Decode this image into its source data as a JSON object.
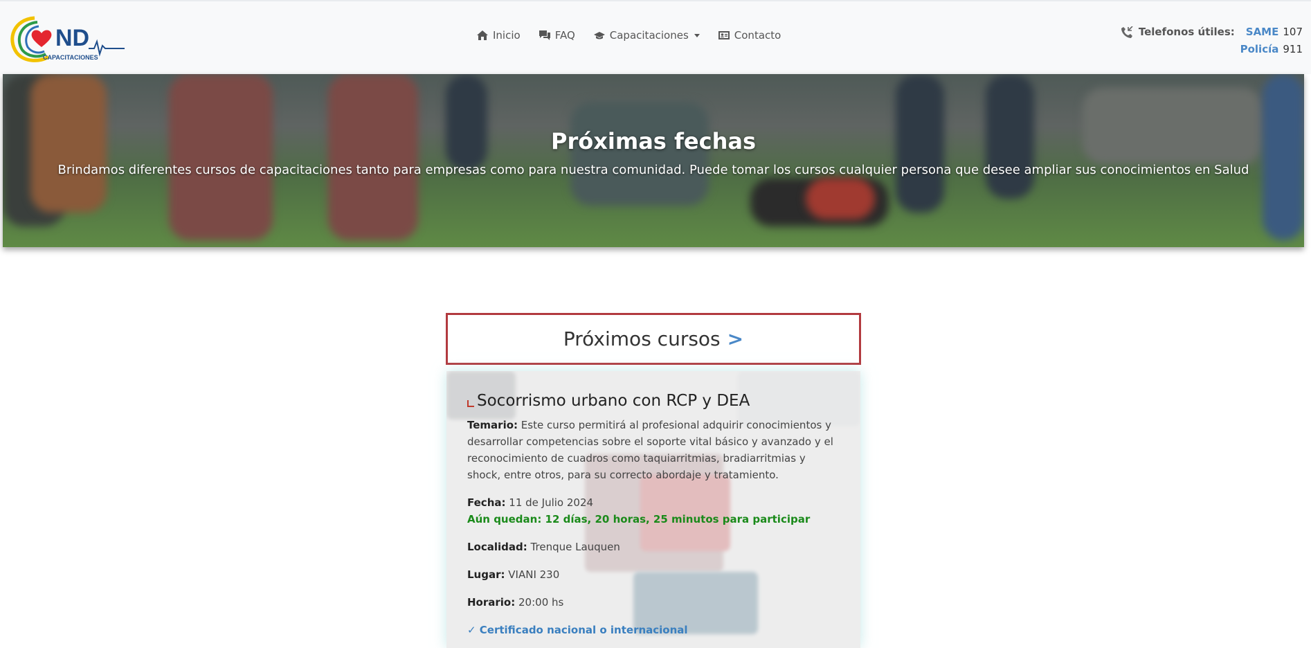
{
  "brand": {
    "logo_text": "ND",
    "logo_subtext": "CAPACITACIONES"
  },
  "nav": {
    "items": [
      {
        "label": "Inicio",
        "icon": "home-icon"
      },
      {
        "label": "FAQ",
        "icon": "chat-icon"
      },
      {
        "label": "Capacitaciones",
        "icon": "graduation-cap-icon"
      },
      {
        "label": "Contacto",
        "icon": "contact-card-icon"
      }
    ]
  },
  "phones": {
    "label": "Telefonos útiles:",
    "same_org": "SAME",
    "same_num": "107",
    "police_org": "Policía",
    "police_num": "911"
  },
  "hero": {
    "title": "Próximas fechas",
    "subtitle": "Brindamos diferentes cursos de capacitaciones tanto para empresas como para nuestra comunidad. Puede tomar los cursos cualquier persona que desee ampliar sus conocimientos en Salud"
  },
  "courses": {
    "header": "Próximos cursos",
    "arrow": ">"
  },
  "course": {
    "title": "Socorrismo urbano con RCP y DEA",
    "temario_label": "Temario:",
    "temario": "Este curso permitirá al profesional adquirir conocimientos y desarrollar competencias sobre el soporte vital básico y avanzado y el reconocimiento de cuadros como taquiarritmias, bradiarritmias y shock, entre otros, para su correcto abordaje y tratamiento.",
    "fecha_label": "Fecha:",
    "fecha": "11 de Julio 2024",
    "countdown": "Aún quedan: 12 días, 20 horas, 25 minutos para participar",
    "localidad_label": "Localidad:",
    "localidad": "Trenque Lauquen",
    "lugar_label": "Lugar:",
    "lugar": "VIANI 230",
    "horario_label": "Horario:",
    "horario": "20:00 hs",
    "cert": "✓ Certificado nacional o internacional"
  },
  "colors": {
    "accent_blue": "#4a88c7",
    "border_red": "#b23a3f",
    "countdown_green": "#1a8a1a"
  }
}
